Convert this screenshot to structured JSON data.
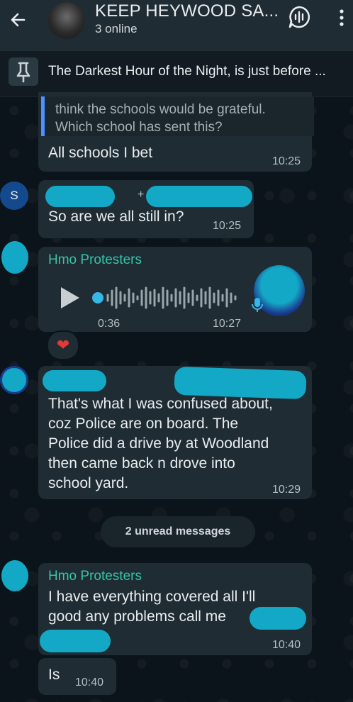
{
  "header": {
    "title": "KEEP HEYWOOD SA...",
    "subtitle": "3 online"
  },
  "pinned": {
    "text": "The Darkest Hour of the Night, is just before ..."
  },
  "messages": [
    {
      "quote_lines": [
        "think the schools would be grateful.",
        "Which school has sent this?"
      ],
      "text": "All schools I bet",
      "time": "10:25"
    },
    {
      "avatar_letter": "S",
      "text": "So are we all still in?",
      "plus": "+",
      "time": "10:25"
    },
    {
      "sender": "Hmo Protesters",
      "audio_elapsed": "0:36",
      "time": "10:27",
      "reaction": "❤"
    },
    {
      "lines": [
        "That's what I was confused about,",
        "coz Police are on board. The",
        "Police did a drive by at Woodland",
        "then came back n drove into",
        "school yard."
      ],
      "time": "10:29"
    },
    {
      "unread_label": "2 unread messages"
    },
    {
      "sender": "Hmo Protesters",
      "lines": [
        "I have everything covered all I'll",
        "good any problems call me"
      ],
      "time": "10:40"
    },
    {
      "text": "Is",
      "time": "10:40"
    }
  ],
  "colors": {
    "background": "#0b141a",
    "header": "#1f2c34",
    "bubble": "#1f2c34",
    "sender_name": "#35c6a6",
    "redaction": "#13a9c6",
    "quote_bar": "#4d90ff"
  }
}
